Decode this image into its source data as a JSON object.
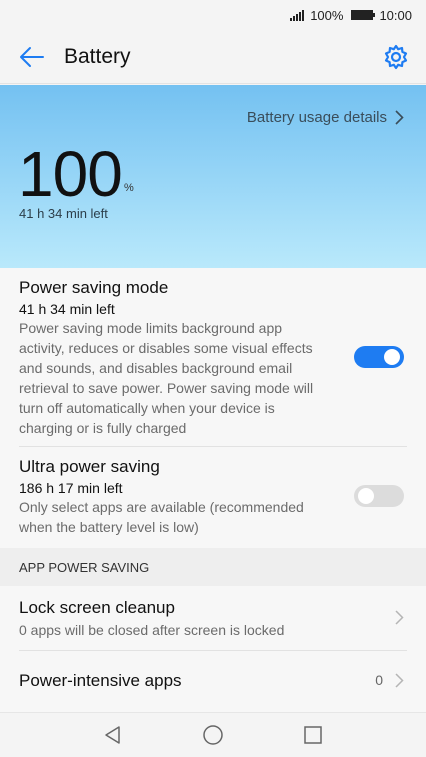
{
  "status_bar": {
    "battery_percent": "100%",
    "time": "10:00"
  },
  "app_bar": {
    "title": "Battery",
    "back_icon": "arrow-left-icon",
    "settings_icon": "gear-icon"
  },
  "hero": {
    "usage_link": "Battery usage details",
    "percent": "100",
    "unit": "%",
    "time_left": "41 h 34 min left"
  },
  "power_saving": {
    "title": "Power saving mode",
    "time_left": "41 h 34 min left",
    "description": "Power saving mode limits background app activity, reduces or disables some visual effects and sounds, and disables background email retrieval to save power. Power saving mode will turn off automatically when your device is charging or is fully charged",
    "enabled": true
  },
  "ultra_power_saving": {
    "title": "Ultra power saving",
    "time_left": "186 h 17 min left",
    "description": "Only select apps are available (recommended when the battery level is low)",
    "enabled": false
  },
  "app_power_saving": {
    "header": "APP POWER SAVING",
    "lock_screen": {
      "title": "Lock screen cleanup",
      "subtitle": "0 apps will be closed after screen is locked"
    },
    "power_intensive": {
      "title": "Power-intensive apps",
      "count": "0"
    }
  },
  "colors": {
    "accent": "#1e7cf2",
    "hero_top": "#74c1f1",
    "hero_bottom": "#b9e9fb"
  }
}
